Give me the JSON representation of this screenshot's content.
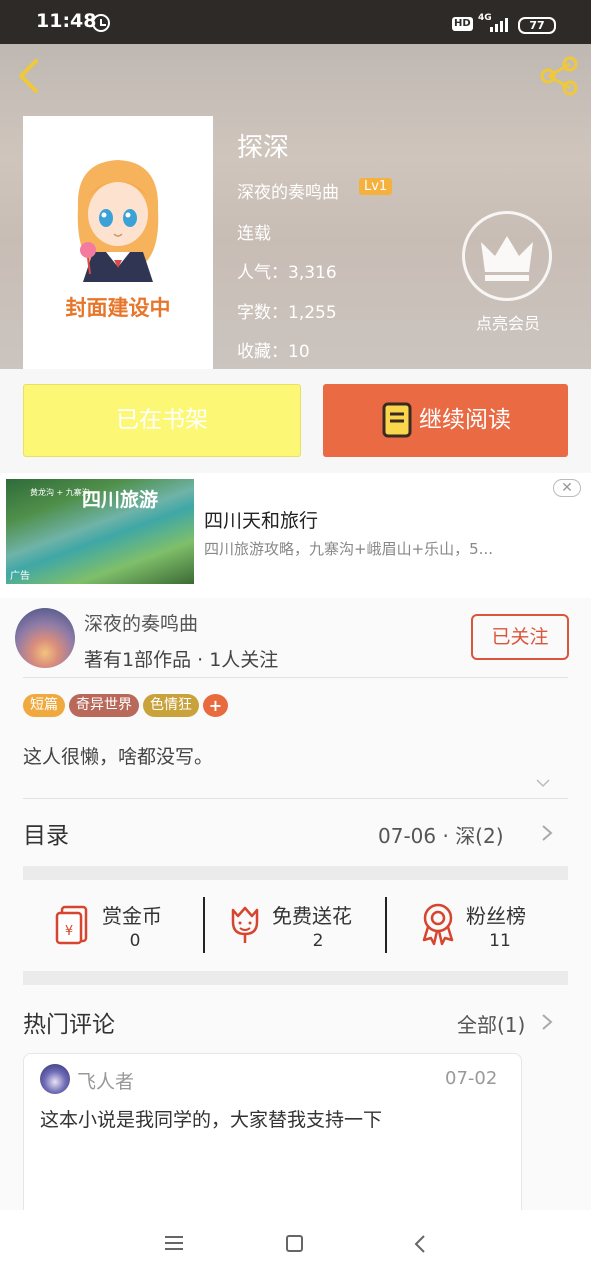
{
  "status_bar": {
    "time": "11:48",
    "hd": "HD",
    "network": "4G",
    "battery": "77"
  },
  "book": {
    "title": "探深",
    "author": "深夜的奏鸣曲",
    "level": "Lv1",
    "status": "连载",
    "popularity": "人气：3,316",
    "word_count": "字数：1,255",
    "favorites": "收藏：10",
    "cover_text": "封面建设中",
    "vip_label": "点亮会员"
  },
  "actions": {
    "shelf_label": "已在书架",
    "read_label": "继续阅读"
  },
  "ad": {
    "image_title": "四川旅游",
    "image_small": "黄龙沟 + 九寨沟",
    "image_tag": "广告",
    "name": "四川天和旅行",
    "description": "四川旅游攻略，九寨沟+峨眉山+乐山，5...",
    "close": "✕"
  },
  "author_card": {
    "name": "深夜的奏鸣曲",
    "stats": "著有1部作品 · 1人关注",
    "follow_label": "已关注",
    "tags": [
      {
        "label": "短篇",
        "color": "#f0a93e"
      },
      {
        "label": "奇异世界",
        "color": "#b8695a"
      },
      {
        "label": "色情狂",
        "color": "#c9a23b"
      }
    ],
    "tag_more": "+",
    "bio": "这人很懒，啥都没写。"
  },
  "catalog": {
    "title": "目录",
    "latest": "07-06 · 深(2)"
  },
  "stats": [
    {
      "label": "赏金币",
      "value": "0",
      "icon": "red-envelope-icon"
    },
    {
      "label": "免费送花",
      "value": "2",
      "icon": "flower-icon"
    },
    {
      "label": "粉丝榜",
      "value": "11",
      "icon": "medal-icon"
    }
  ],
  "comments": {
    "title": "热门评论",
    "all_label": "全部(1)",
    "items": [
      {
        "user": "飞人者",
        "date": "07-02",
        "text": "这本小说是我同学的，大家替我支持一下"
      }
    ]
  },
  "colors": {
    "accent": "#ea6a43",
    "shelf": "#fdf776",
    "icon_red": "#d6452e"
  }
}
